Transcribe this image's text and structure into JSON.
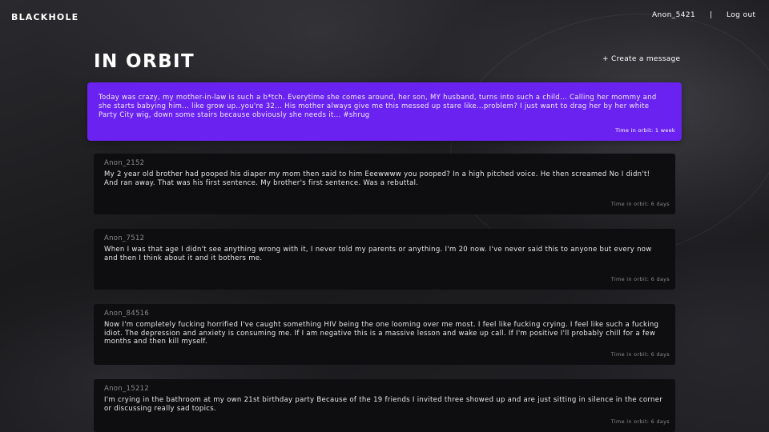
{
  "header": {
    "brand": "BLACKHOLE",
    "username": "Anon_5421",
    "separator": "|",
    "logout_label": "Log out"
  },
  "page": {
    "title": "IN ORBIT",
    "create_label": "+ Create a message"
  },
  "highlight": {
    "message": "Today was crazy, my mother-in-law is such a b*tch. Everytime she comes around, her son, MY husband, turns into such a child... Calling her mommy and she starts babying him... like grow up..you're 32... His mother always give me this messed up stare like...problem? I just want to drag her by her white Party City wig, down some stairs because obviously she needs it... #shrug",
    "time": "Time in orbit: 1 week",
    "color": "#6a22f0"
  },
  "messages": [
    {
      "author": "Anon_2152",
      "text": "My 2 year old brother had pooped his diaper my mom then said to him Eeewwww you pooped? In a high pitched voice. He then screamed No I didn't! And ran away. That was his first sentence. My brother's first sentence. Was a rebuttal.",
      "time": "Time in orbit: 6 days"
    },
    {
      "author": "Anon_7512",
      "text": "When I was that age I didn't see anything wrong with it, I never told my parents or anything. I'm 20 now. I've never said this to anyone but every now and then I think about it and it bothers me.",
      "time": "Time in orbit: 6 days"
    },
    {
      "author": "Anon_84516",
      "text": "Now I'm completely fucking horrified I've caught something HIV being the one looming over me most. I feel like fucking crying. I feel like such a fucking idiot. The depression and anxiety is consuming me. If I am negative this is a massive lesson and wake up call. If I'm positive I'll probably chill for a few months and then kill myself.",
      "time": "Time in orbit: 6 days"
    },
    {
      "author": "Anon_15212",
      "text": "I'm crying in the bathroom at my own 21st birthday party Because of the 19 friends I invited three showed up and are just sitting in silence in the corner or discussing really sad topics.",
      "time": "Time in orbit: 6 days"
    }
  ]
}
